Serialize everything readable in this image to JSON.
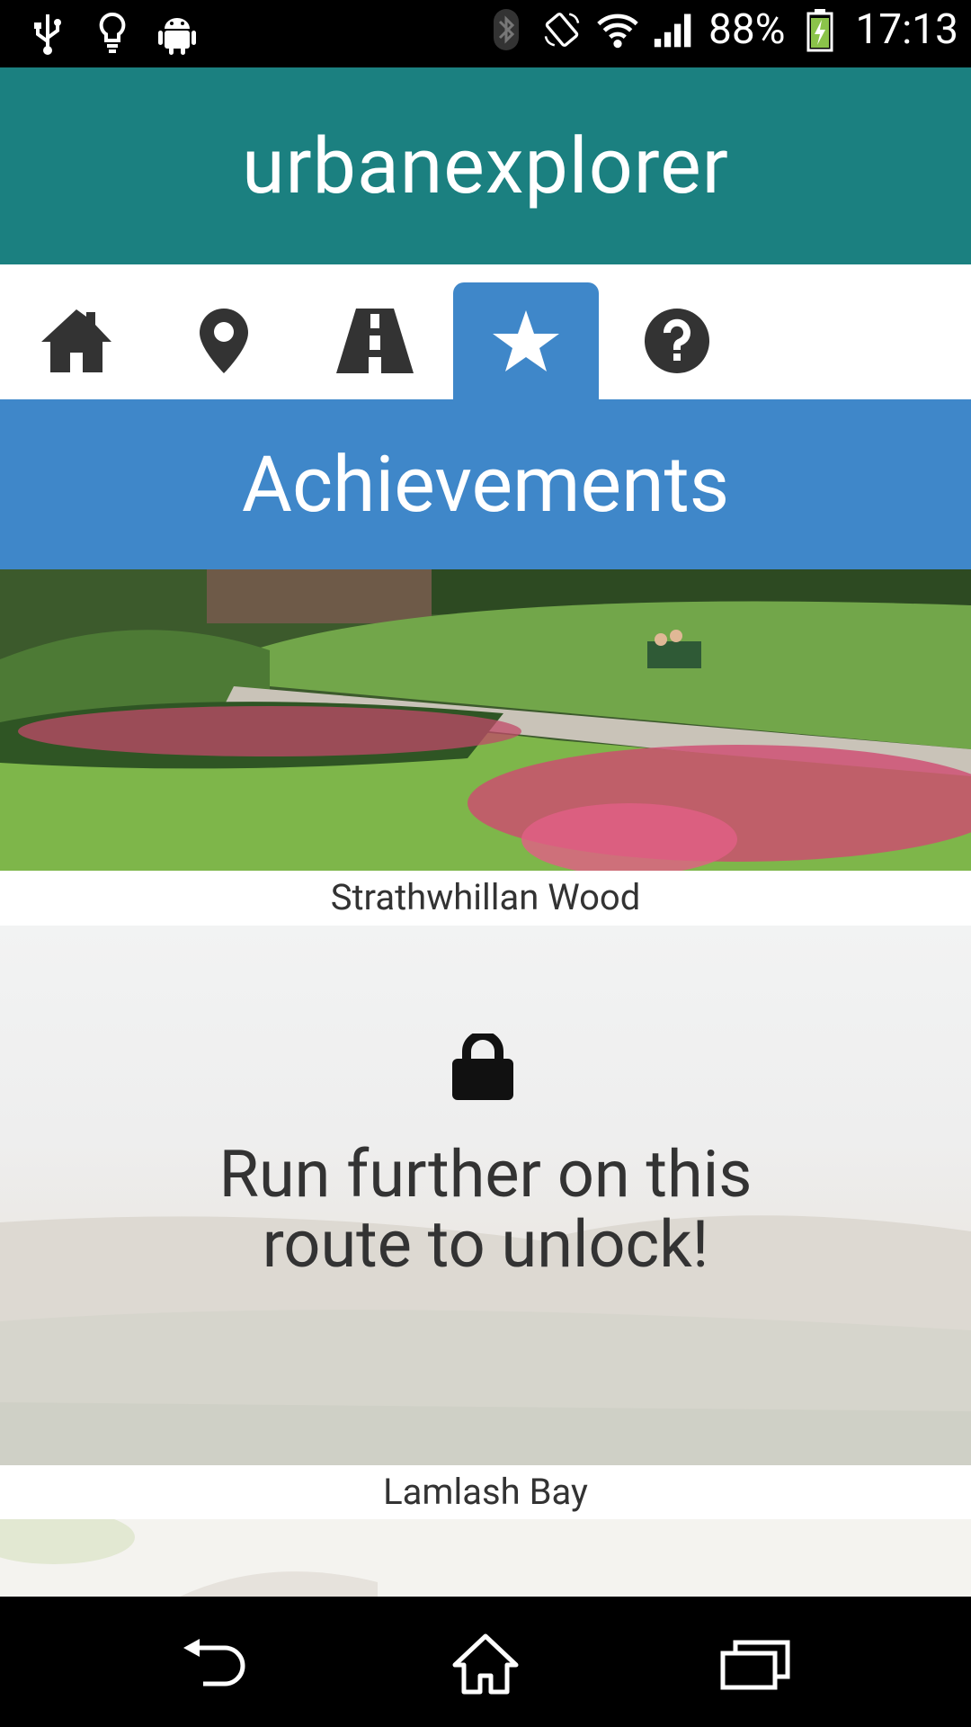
{
  "status_bar": {
    "left_icons": [
      "usb-icon",
      "lightbulb-icon",
      "android-icon"
    ],
    "right_icons": [
      "bluetooth-icon",
      "rotate-icon",
      "wifi-icon",
      "signal-icon"
    ],
    "battery_percent": "88%",
    "time": "17:13"
  },
  "app": {
    "title": "urbanexplorer"
  },
  "tabs": [
    {
      "name": "home-icon",
      "active": false
    },
    {
      "name": "map-pin-icon",
      "active": false
    },
    {
      "name": "road-icon",
      "active": false
    },
    {
      "name": "star-icon",
      "active": true
    },
    {
      "name": "help-icon",
      "active": false
    }
  ],
  "section": {
    "title": "Achievements"
  },
  "achievements": [
    {
      "name": "Strathwhillan Wood",
      "locked": false
    },
    {
      "name": "Lamlash Bay",
      "locked": true,
      "lock_message": "Run further on this route to unlock!"
    }
  ],
  "nav_bar": [
    "back-icon",
    "home-outline-icon",
    "recents-icon"
  ],
  "colors": {
    "app_bar": "#1b8080",
    "accent": "#3f87c9"
  }
}
